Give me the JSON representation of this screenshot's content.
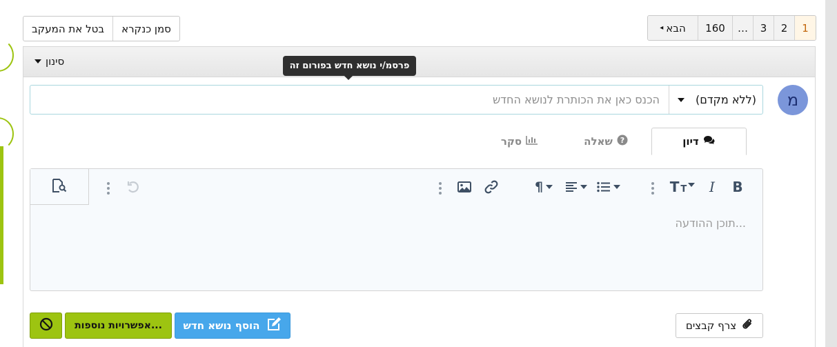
{
  "thread_actions": {
    "untrack_label": "בטל את המעקב",
    "mark_read_label": "סמן כנקרא"
  },
  "pagination": {
    "next_label": "הבא",
    "pages": [
      "160",
      "…",
      "3",
      "2",
      "1"
    ],
    "current_page": "1"
  },
  "filter": {
    "label": "סינון"
  },
  "tooltip": {
    "text": "פרסמ/י נושא חדש בפורום זה"
  },
  "avatar": {
    "letter": "מ",
    "color": "#7b96da"
  },
  "new_thread": {
    "prefix_value": "(ללא מקדם)",
    "title_placeholder": "הכנס כאן את הכותרת לנושא החדש"
  },
  "tabs": [
    {
      "label": "דיון",
      "icon": "comments-icon",
      "active": true
    },
    {
      "label": "שאלה",
      "icon": "question-circle-icon",
      "active": false
    },
    {
      "label": "סקר",
      "icon": "bar-chart-icon",
      "active": false
    }
  ],
  "editor": {
    "body_placeholder": "תוכן ההודעה...",
    "toolbar_icons": [
      "bold-icon",
      "italic-icon",
      "text-size-icon",
      "more-vertical-icon",
      "list-icon",
      "align-icon",
      "paragraph-icon",
      "link-icon",
      "image-icon",
      "more-vertical-icon",
      "undo-icon",
      "more-vertical-icon",
      "preview-icon"
    ]
  },
  "footer": {
    "attach_label": "צרף קבצים",
    "post_label": "הוסף נושא חדש",
    "more_options_label": "אפשרויות נוספות...",
    "accent_green": "#9dc411",
    "accent_blue": "#47a7eb"
  }
}
